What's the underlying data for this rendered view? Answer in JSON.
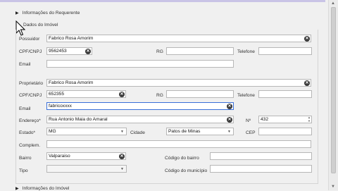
{
  "sections": {
    "requerente": "Informações do Requerente",
    "imovel_dados": "Dados do Imóvel",
    "imovel_info": "Informações do Imóvel"
  },
  "labels": {
    "possuidor": "Possuidor",
    "cpf_cnpj": "CPF/CNPJ",
    "rg": "RG",
    "telefone": "Telefone",
    "email": "Email",
    "proprietario": "Proprietário",
    "endereco": "Endereço*",
    "numero": "Nº",
    "estado": "Estado*",
    "cidade": "Cidade",
    "cep": "CEP",
    "complem": "Complem.",
    "bairro": "Bairro",
    "codigo_bairro": "Código do bairro",
    "tipo": "Tipo",
    "codigo_municipio": "Código do município"
  },
  "values": {
    "possuidor": "Fabrico Rosa Amorim",
    "possuidor_cpf": "9562453",
    "proprietario": "Fabrico Rosa Amorim",
    "proprietario_cpf": "652355",
    "proprietario_email": "fabricoxxxx",
    "endereco": "Rua Antonio Maia do Amaral",
    "numero": "432",
    "estado": "MG",
    "cidade": "Patos de Minas",
    "bairro": "Valparaiso"
  },
  "icons": {
    "clear": "✕"
  }
}
